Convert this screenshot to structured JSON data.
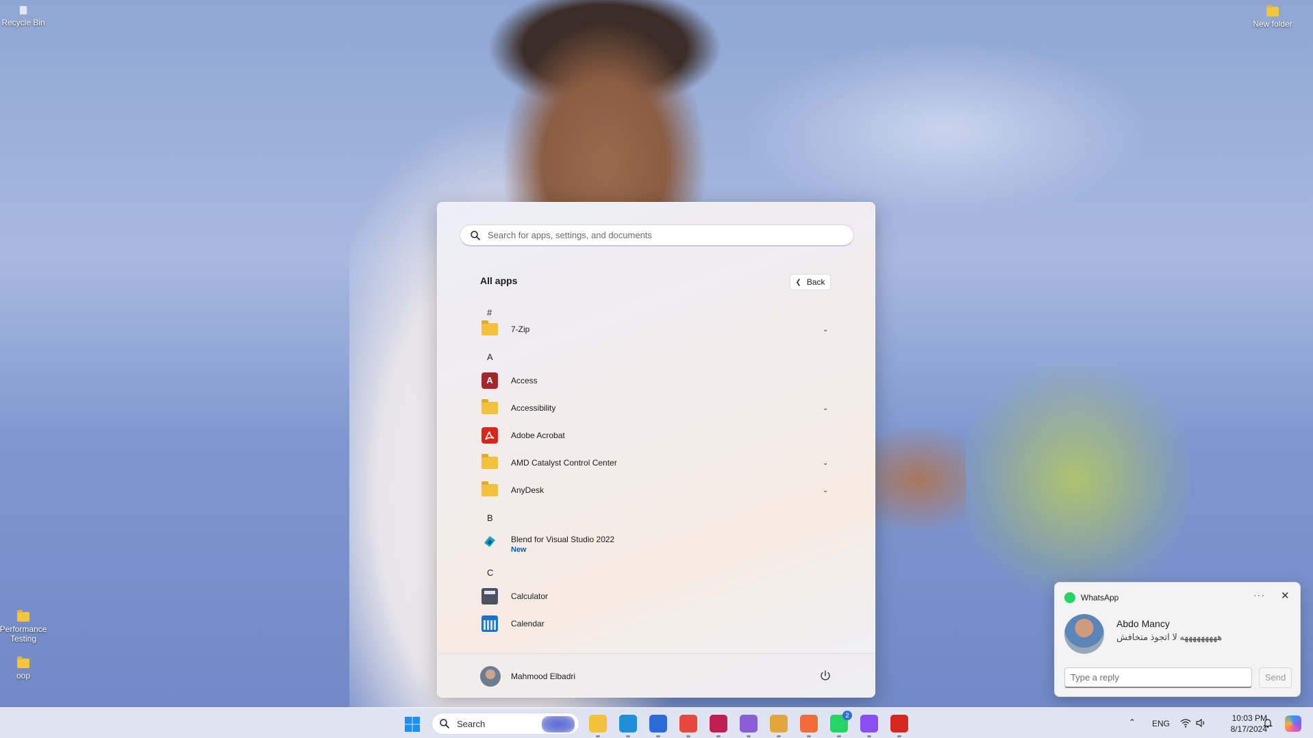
{
  "desktop": {
    "icons": [
      {
        "label": "Recycle Bin"
      },
      {
        "label": "New folder"
      },
      {
        "label": "Performance Testing"
      },
      {
        "label": "oop"
      }
    ]
  },
  "start_menu": {
    "search_placeholder": "Search for apps, settings, and documents",
    "title": "All apps",
    "back_label": "Back",
    "apps": [
      {
        "type": "letter",
        "label": "#"
      },
      {
        "type": "app",
        "label": "7-Zip",
        "icon": "folder-icon",
        "expandable": true
      },
      {
        "type": "letter",
        "label": "A"
      },
      {
        "type": "app",
        "label": "Access",
        "icon": "access-icon",
        "icon_text": "A"
      },
      {
        "type": "app",
        "label": "Accessibility",
        "icon": "folder-icon",
        "expandable": true
      },
      {
        "type": "app",
        "label": "Adobe Acrobat",
        "icon": "acrobat-icon"
      },
      {
        "type": "app",
        "label": "AMD Catalyst Control Center",
        "icon": "folder-icon",
        "expandable": true
      },
      {
        "type": "app",
        "label": "AnyDesk",
        "icon": "folder-icon",
        "expandable": true
      },
      {
        "type": "letter",
        "label": "B"
      },
      {
        "type": "app",
        "label": "Blend for Visual Studio 2022",
        "icon": "blend-icon",
        "sub": "New"
      },
      {
        "type": "letter",
        "label": "C"
      },
      {
        "type": "app",
        "label": "Calculator",
        "icon": "calculator-icon"
      },
      {
        "type": "app",
        "label": "Calendar",
        "icon": "calendar-icon"
      }
    ],
    "user_name": "Mahmood Elbadri"
  },
  "notification": {
    "app_name": "WhatsApp",
    "more_label": "···",
    "close_label": "✕",
    "sender": "Abdo Mancy",
    "message": "هههههههههه لا اتجوذ متخافش",
    "reply_placeholder": "Type a reply",
    "send_label": "Send"
  },
  "taskbar": {
    "search_label": "Search",
    "apps": [
      {
        "name": "file-explorer-icon",
        "color": "#f2c23a"
      },
      {
        "name": "edge-icon",
        "color": "#1f8fd8"
      },
      {
        "name": "microsoft-store-icon",
        "color": "#2b6cd6"
      },
      {
        "name": "chrome-icon",
        "color": "#e9473b"
      },
      {
        "name": "rider-icon",
        "color": "#c21d52"
      },
      {
        "name": "visual-studio-icon",
        "color": "#8b5ed6"
      },
      {
        "name": "snipping-tool-icon",
        "color": "#e2a63b"
      },
      {
        "name": "postman-icon",
        "color": "#f26b3a"
      },
      {
        "name": "whatsapp-icon",
        "color": "#25d366",
        "badge": "2"
      },
      {
        "name": "messenger-icon",
        "color": "#8a4df0"
      },
      {
        "name": "acrobat-icon",
        "color": "#d7261e"
      }
    ],
    "tray": {
      "language": "ENG",
      "time": "10:03 PM",
      "date": "8/17/2024"
    }
  }
}
